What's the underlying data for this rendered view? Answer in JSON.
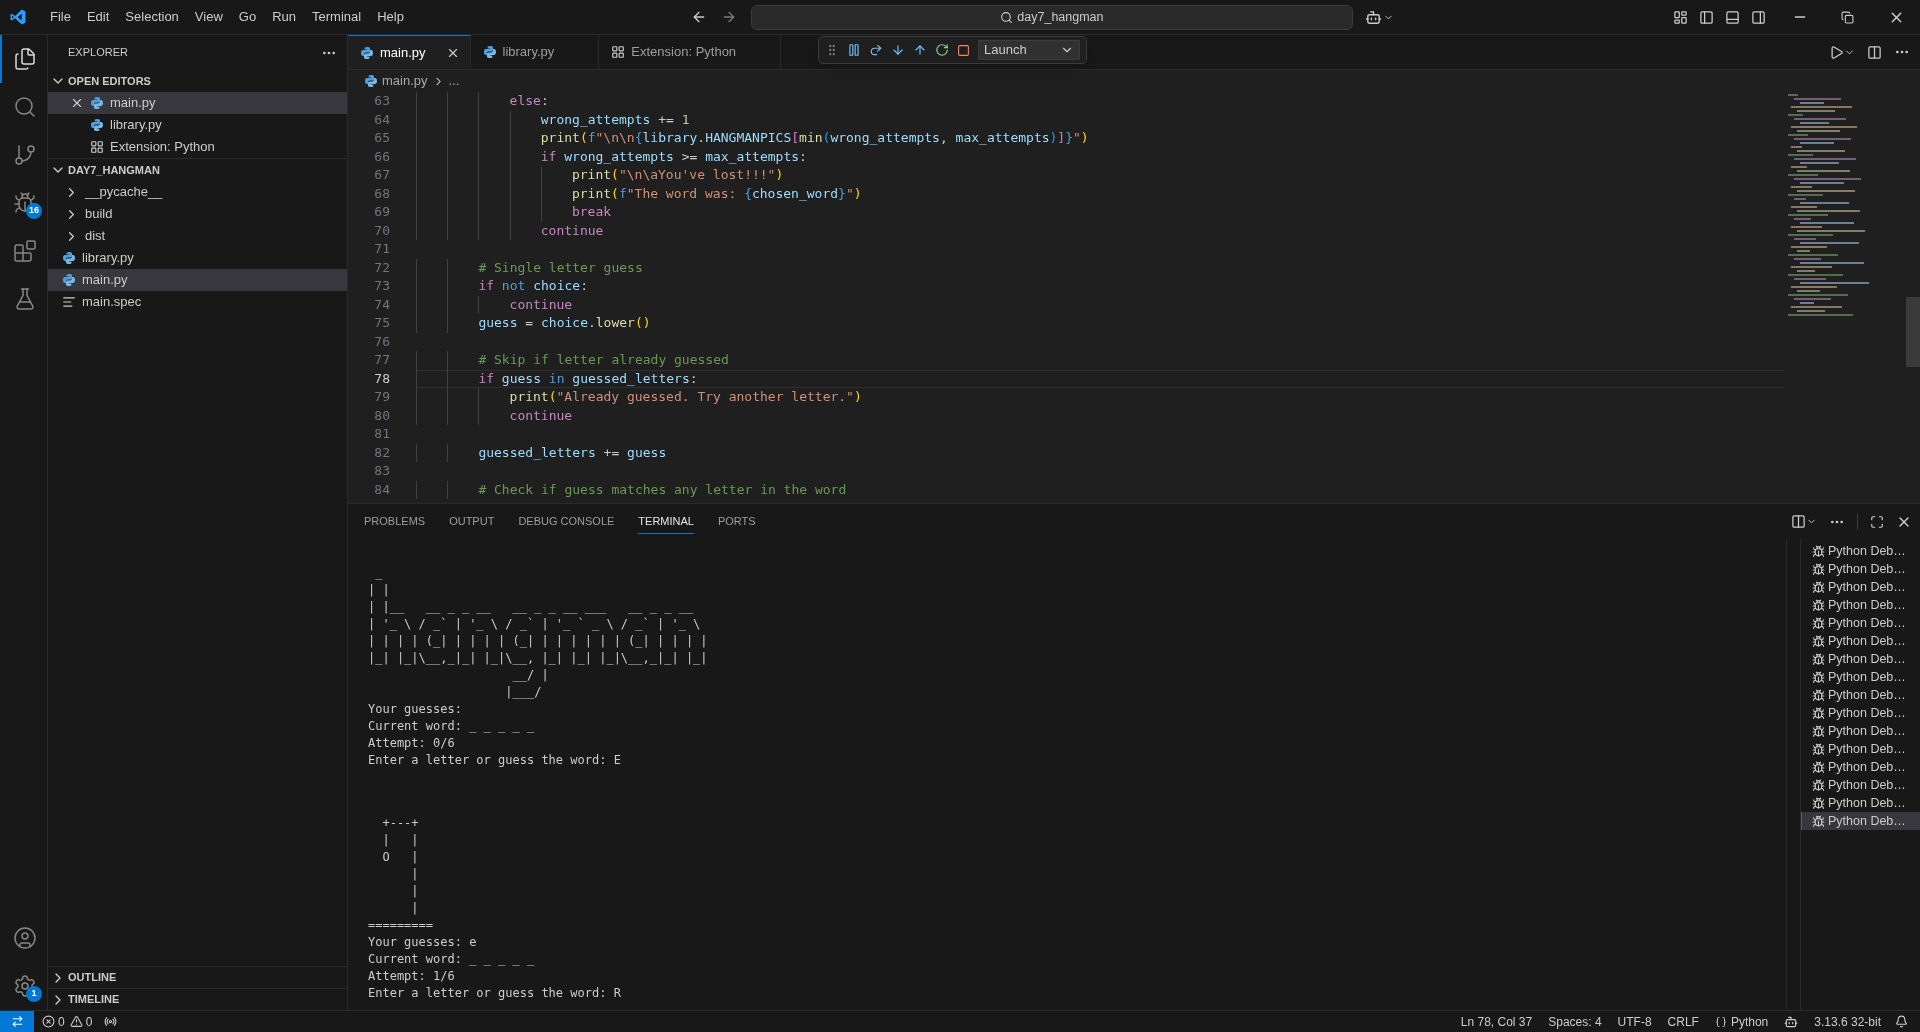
{
  "title_bar": {
    "menus": [
      "File",
      "Edit",
      "Selection",
      "View",
      "Go",
      "Run",
      "Terminal",
      "Help"
    ],
    "search": "day7_hangman"
  },
  "debug_toolbar": {
    "configuration": "Launch"
  },
  "activity_bar": {
    "items": [
      {
        "kind": "explorer",
        "selected": true
      },
      {
        "kind": "search",
        "selected": false
      },
      {
        "kind": "scm",
        "selected": false
      },
      {
        "kind": "debug",
        "selected": false,
        "badge": "16"
      },
      {
        "kind": "extensions",
        "selected": false
      },
      {
        "kind": "testing",
        "selected": false
      }
    ],
    "bottom": [
      {
        "kind": "account"
      },
      {
        "kind": "manage",
        "badge": "1"
      }
    ]
  },
  "sidebar": {
    "title": "EXPLORER",
    "sections": [
      {
        "title": "OPEN EDITORS",
        "expanded": true,
        "items": [
          {
            "label": "main.py",
            "kind": "python",
            "selected": true
          },
          {
            "label": "library.py",
            "kind": "python",
            "selected": false
          },
          {
            "label": "Extension: Python",
            "kind": "extension",
            "selected": false
          }
        ]
      },
      {
        "title": "DAY7_HANGMAN",
        "expanded": true,
        "items": [
          {
            "label": "__pycache__",
            "kind": "folder",
            "expanded": false,
            "selected": false
          },
          {
            "label": "build",
            "kind": "folder",
            "expanded": false,
            "selected": false
          },
          {
            "label": "dist",
            "kind": "folder",
            "expanded": false,
            "selected": false
          },
          {
            "label": "library.py",
            "kind": "python",
            "selected": false
          },
          {
            "label": "main.py",
            "kind": "python",
            "selected": true
          },
          {
            "label": "main.spec",
            "kind": "spec",
            "selected": false
          }
        ]
      }
    ],
    "bottom_sections": [
      {
        "title": "OUTLINE",
        "expanded": false
      },
      {
        "title": "TIMELINE",
        "expanded": false
      }
    ]
  },
  "editor": {
    "tabs": [
      {
        "label": "main.py",
        "kind": "python",
        "selected": true
      },
      {
        "label": "library.py",
        "kind": "python",
        "selected": false
      },
      {
        "label": "Extension: Python",
        "kind": "extension",
        "selected": false
      }
    ],
    "breadcrumb": [
      "main.py",
      "..."
    ],
    "lines": [
      {
        "number": "63",
        "current": false,
        "tokens": [
          {
            "t": "            else",
            "kind": "kw"
          },
          {
            "t": ":",
            "kind": "plain"
          }
        ]
      },
      {
        "number": "64",
        "current": false,
        "tokens": [
          {
            "t": "                wrong_attempts",
            "kind": "var"
          },
          {
            "t": " += ",
            "kind": "plain"
          },
          {
            "t": "1",
            "kind": "num"
          }
        ]
      },
      {
        "number": "65",
        "current": false,
        "tokens": [
          {
            "t": "                print",
            "kind": "fn"
          },
          {
            "t": "(",
            "kind": "b1"
          },
          {
            "t": "f",
            "kind": "op"
          },
          {
            "t": "\"\\n\\n",
            "kind": "str"
          },
          {
            "t": "{",
            "kind": "op"
          },
          {
            "t": "library",
            "kind": "var"
          },
          {
            "t": ".",
            "kind": "plain"
          },
          {
            "t": "HANGMANPICS",
            "kind": "var"
          },
          {
            "t": "[",
            "kind": "b2"
          },
          {
            "t": "min",
            "kind": "fn"
          },
          {
            "t": "(",
            "kind": "b3"
          },
          {
            "t": "wrong_attempts",
            "kind": "var"
          },
          {
            "t": ", ",
            "kind": "plain"
          },
          {
            "t": "max_attempts",
            "kind": "var"
          },
          {
            "t": ")",
            "kind": "b3"
          },
          {
            "t": "]",
            "kind": "b2"
          },
          {
            "t": "}",
            "kind": "op"
          },
          {
            "t": "\"",
            "kind": "str"
          },
          {
            "t": ")",
            "kind": "b1"
          }
        ]
      },
      {
        "number": "66",
        "current": false,
        "tokens": [
          {
            "t": "                if",
            "kind": "kw"
          },
          {
            "t": " wrong_attempts",
            "kind": "var"
          },
          {
            "t": " >= ",
            "kind": "plain"
          },
          {
            "t": "max_attempts",
            "kind": "var"
          },
          {
            "t": ":",
            "kind": "plain"
          }
        ]
      },
      {
        "number": "67",
        "current": false,
        "tokens": [
          {
            "t": "                    print",
            "kind": "fn"
          },
          {
            "t": "(",
            "kind": "b1"
          },
          {
            "t": "\"\\n\\aYou've lost!!!\"",
            "kind": "str"
          },
          {
            "t": ")",
            "kind": "b1"
          }
        ]
      },
      {
        "number": "68",
        "current": false,
        "tokens": [
          {
            "t": "                    print",
            "kind": "fn"
          },
          {
            "t": "(",
            "kind": "b1"
          },
          {
            "t": "f",
            "kind": "op"
          },
          {
            "t": "\"The word was: ",
            "kind": "str"
          },
          {
            "t": "{",
            "kind": "op"
          },
          {
            "t": "chosen_word",
            "kind": "var"
          },
          {
            "t": "}",
            "kind": "op"
          },
          {
            "t": "\"",
            "kind": "str"
          },
          {
            "t": ")",
            "kind": "b1"
          }
        ]
      },
      {
        "number": "69",
        "current": false,
        "tokens": [
          {
            "t": "                    break",
            "kind": "kw"
          }
        ]
      },
      {
        "number": "70",
        "current": false,
        "tokens": [
          {
            "t": "                continue",
            "kind": "kw"
          }
        ]
      },
      {
        "number": "71",
        "current": false
      },
      {
        "number": "72",
        "current": false,
        "tokens": [
          {
            "t": "        # Single letter guess",
            "kind": "cmt"
          }
        ]
      },
      {
        "number": "73",
        "current": false,
        "tokens": [
          {
            "t": "        if",
            "kind": "kw"
          },
          {
            "t": " not",
            "kind": "op"
          },
          {
            "t": " choice",
            "kind": "var"
          },
          {
            "t": ":",
            "kind": "plain"
          }
        ]
      },
      {
        "number": "74",
        "current": false,
        "tokens": [
          {
            "t": "            continue",
            "kind": "kw"
          }
        ]
      },
      {
        "number": "75",
        "current": false,
        "tokens": [
          {
            "t": "        guess",
            "kind": "var"
          },
          {
            "t": " = ",
            "kind": "plain"
          },
          {
            "t": "choice",
            "kind": "var"
          },
          {
            "t": ".",
            "kind": "plain"
          },
          {
            "t": "lower",
            "kind": "fn"
          },
          {
            "t": "()",
            "kind": "b1"
          }
        ]
      },
      {
        "number": "76",
        "current": false
      },
      {
        "number": "77",
        "current": false,
        "tokens": [
          {
            "t": "        # Skip if letter already guessed",
            "kind": "cmt"
          }
        ]
      },
      {
        "number": "78",
        "current": true,
        "tokens": [
          {
            "t": "        if",
            "kind": "kw"
          },
          {
            "t": " guess",
            "kind": "var"
          },
          {
            "t": " in",
            "kind": "op"
          },
          {
            "t": " guessed_letters",
            "kind": "var"
          },
          {
            "t": ":",
            "kind": "plain"
          }
        ]
      },
      {
        "number": "79",
        "current": false,
        "tokens": [
          {
            "t": "            print",
            "kind": "fn"
          },
          {
            "t": "(",
            "kind": "b1"
          },
          {
            "t": "\"Already guessed. Try another letter.\"",
            "kind": "str"
          },
          {
            "t": ")",
            "kind": "b1"
          }
        ]
      },
      {
        "number": "80",
        "current": false,
        "tokens": [
          {
            "t": "            continue",
            "kind": "kw"
          }
        ]
      },
      {
        "number": "81",
        "current": false
      },
      {
        "number": "82",
        "current": false,
        "tokens": [
          {
            "t": "        guessed_letters",
            "kind": "var"
          },
          {
            "t": " += ",
            "kind": "plain"
          },
          {
            "t": "guess",
            "kind": "var"
          }
        ]
      },
      {
        "number": "83",
        "current": false
      },
      {
        "number": "84",
        "current": false,
        "tokens": [
          {
            "t": "        # Check if guess matches any letter in the word",
            "kind": "cmt"
          }
        ]
      }
    ]
  },
  "panel": {
    "tabs": [
      {
        "label": "PROBLEMS",
        "selected": false
      },
      {
        "label": "OUTPUT",
        "selected": false
      },
      {
        "label": "DEBUG CONSOLE",
        "selected": false
      },
      {
        "label": "TERMINAL",
        "selected": true
      },
      {
        "label": "PORTS",
        "selected": false
      }
    ],
    "terminal": [
      {
        "lines": [
          " _",
          "| |",
          "| |__   __ _ _ __   __ _ _ __ ___   __ _ _ __",
          "| '_ \\ / _` | '_ \\ / _` | '_ ` _ \\ / _` | '_ \\",
          "| | | | (_| | | | | (_| | | | | | | (_| | | | |",
          "|_| |_|\\__,_|_| |_|\\__, |_| |_| |_|\\__,_|_| |_|",
          "                    __/ |",
          "                   |___/",
          "Your guesses:",
          "Current word: _ _ _ _ _",
          "Attempt: 0/6",
          "Enter a letter or guess the word: E"
        ]
      },
      {
        "lines": [
          "  +---+",
          "  |   |",
          "  O   |",
          "      |",
          "      |",
          "      |",
          "=========",
          "Your guesses: e",
          "Current word: _ _ _ _ _",
          "Attempt: 1/6",
          "Enter a letter or guess the word: R"
        ]
      }
    ],
    "sessions": [
      {
        "label": "Python Deb…",
        "selected": false
      },
      {
        "label": "Python Deb…",
        "selected": false
      },
      {
        "label": "Python Deb…",
        "selected": false
      },
      {
        "label": "Python Deb…",
        "selected": false
      },
      {
        "label": "Python Deb…",
        "selected": false
      },
      {
        "label": "Python Deb…",
        "selected": false
      },
      {
        "label": "Python Deb…",
        "selected": false
      },
      {
        "label": "Python Deb…",
        "selected": false
      },
      {
        "label": "Python Deb…",
        "selected": false
      },
      {
        "label": "Python Deb…",
        "selected": false
      },
      {
        "label": "Python Deb…",
        "selected": false
      },
      {
        "label": "Python Deb…",
        "selected": false
      },
      {
        "label": "Python Deb…",
        "selected": false
      },
      {
        "label": "Python Deb…",
        "selected": false
      },
      {
        "label": "Python Deb…",
        "selected": false
      },
      {
        "label": "Python Deb…",
        "selected": true
      }
    ]
  },
  "status_bar": {
    "errors": "0",
    "warnings": "0",
    "right": [
      {
        "kind": "text",
        "label": "Ln 78, Col 37"
      },
      {
        "kind": "text",
        "label": "Spaces: 4"
      },
      {
        "kind": "text",
        "label": "UTF-8"
      },
      {
        "kind": "text",
        "label": "CRLF"
      },
      {
        "kind": "language",
        "label": "Python"
      },
      {
        "kind": "copilot"
      },
      {
        "kind": "text",
        "label": "3.13.6 32-bit"
      },
      {
        "kind": "bell"
      }
    ]
  }
}
